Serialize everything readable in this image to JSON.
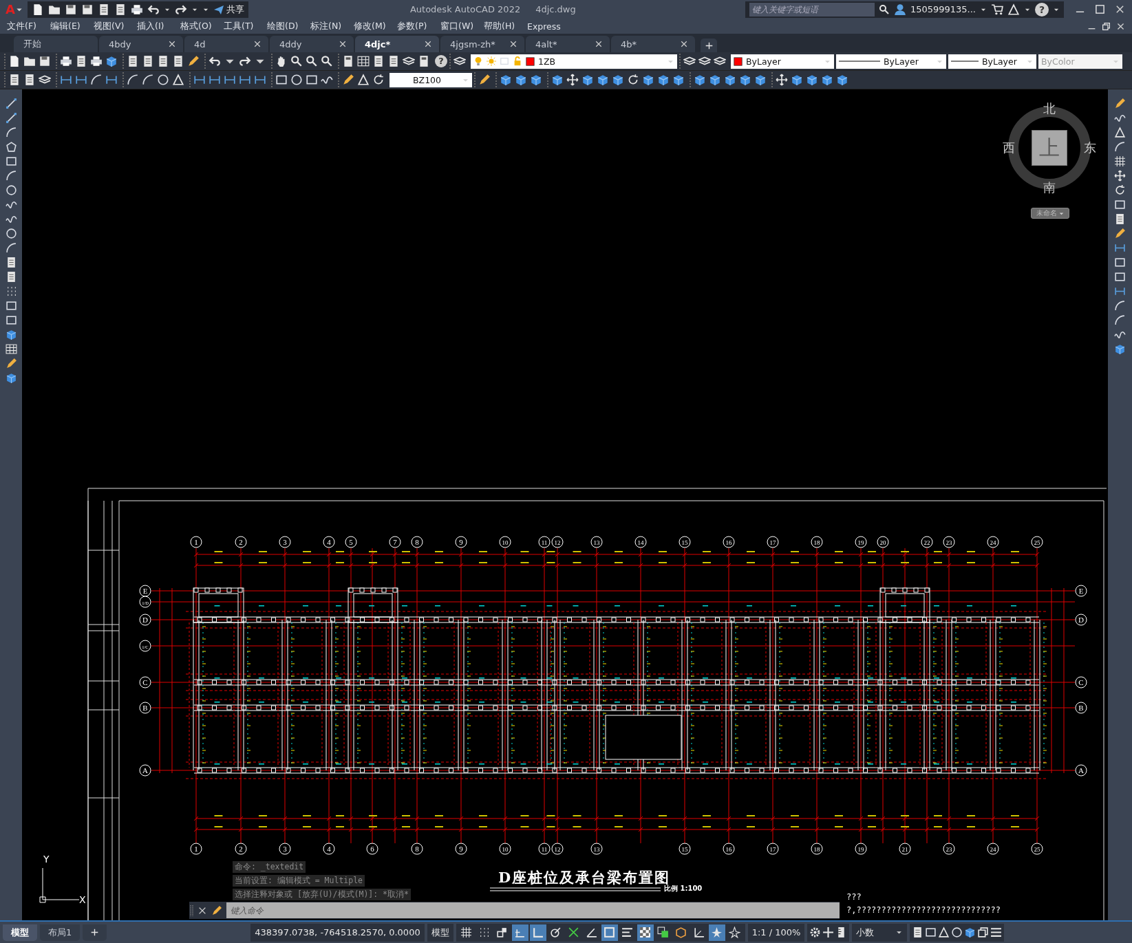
{
  "title_bar": {
    "logo": "A",
    "share_label": "共享",
    "app_title": "Autodesk AutoCAD 2022",
    "file_name": "4djc.dwg",
    "search": {
      "placeholder": "键入关键字或短语"
    },
    "user": "1505999135...",
    "help_glyph": "?"
  },
  "menu": [
    "文件(F)",
    "编辑(E)",
    "视图(V)",
    "插入(I)",
    "格式(O)",
    "工具(T)",
    "绘图(D)",
    "标注(N)",
    "修改(M)",
    "参数(P)",
    "窗口(W)",
    "帮助(H)",
    "Express"
  ],
  "file_tabs": [
    {
      "label": "开始",
      "selected": false,
      "closable": false
    },
    {
      "label": "4bdy",
      "selected": false,
      "closable": true
    },
    {
      "label": "4d",
      "selected": false,
      "closable": true
    },
    {
      "label": "4ddy",
      "selected": false,
      "closable": true
    },
    {
      "label": "4djc*",
      "selected": true,
      "closable": true
    },
    {
      "label": "4jgsm-zh*",
      "selected": false,
      "closable": true
    },
    {
      "label": "4alt*",
      "selected": false,
      "closable": true
    },
    {
      "label": "4b*",
      "selected": false,
      "closable": true
    }
  ],
  "toolbar": {
    "help_glyph": "?",
    "layer": "1ZB",
    "color_setting": "ByLayer",
    "linetype": "ByLayer",
    "lineweight": "ByLayer",
    "plot_style": {
      "label": "ByColor",
      "disabled": true
    },
    "dim_style": "BZ100"
  },
  "viewcube": {
    "north": "北",
    "south": "南",
    "east": "东",
    "west": "西",
    "face": "上",
    "ucs_menu": "未命名"
  },
  "drawing": {
    "title": "D座桩位及承台梁布置图",
    "scale": "比例 1:100",
    "top_axes": [
      "1",
      "2",
      "3",
      "4",
      "5",
      "7",
      "8",
      "9",
      "10",
      "11",
      "12",
      "13",
      "14",
      "15",
      "16",
      "17",
      "18",
      "19",
      "20",
      "22",
      "23",
      "24",
      "25"
    ],
    "bottom_axes": [
      "1",
      "2",
      "3",
      "4",
      "6",
      "8",
      "9",
      "10",
      "11",
      "12",
      "13",
      "15",
      "16",
      "17",
      "18",
      "19",
      "21",
      "23",
      "24",
      "25"
    ],
    "left_axes": [
      "E",
      "1/D",
      "D",
      "1/C",
      "C",
      "B",
      "A"
    ],
    "right_axes": [
      "E",
      "D",
      "C",
      "B",
      "A"
    ]
  },
  "ucs": {
    "x": "X",
    "y": "Y"
  },
  "command": {
    "history": [
      "命令: _textedit",
      "当前设置: 编辑模式 = Multiple",
      "选择注释对象或 [放弃(U)/模式(M)]: *取消*"
    ],
    "placeholder": "键入命令"
  },
  "overlay_text": [
    "???",
    "?,?????????????????????????????"
  ],
  "layout_tabs": [
    {
      "label": "模型",
      "selected": true
    },
    {
      "label": "布局1",
      "selected": false
    }
  ],
  "status_bar": {
    "coordinates": "438397.0738, -764518.2570, 0.0000",
    "space": "模型",
    "annotation_scale": "1:1 / 100%",
    "units": "小数",
    "toggles": [
      {
        "kind": "grid",
        "on": false
      },
      {
        "kind": "dots",
        "on": false
      },
      {
        "kind": "snap",
        "on": false
      },
      {
        "kind": "infer",
        "on": true
      },
      {
        "kind": "ortho",
        "on": true
      },
      {
        "kind": "polar",
        "on": false
      },
      {
        "kind": "track",
        "on": false
      },
      {
        "kind": "angle",
        "on": false
      },
      {
        "kind": "osnap",
        "on": true
      },
      {
        "kind": "lineweight",
        "on": false
      },
      {
        "kind": "transparency",
        "on": true
      },
      {
        "kind": "cycle",
        "on": false
      },
      {
        "kind": "gizmo",
        "on": false
      },
      {
        "kind": "ucs",
        "on": false
      },
      {
        "kind": "visibility",
        "on": true
      },
      {
        "kind": "autoscale",
        "on": false
      }
    ]
  }
}
